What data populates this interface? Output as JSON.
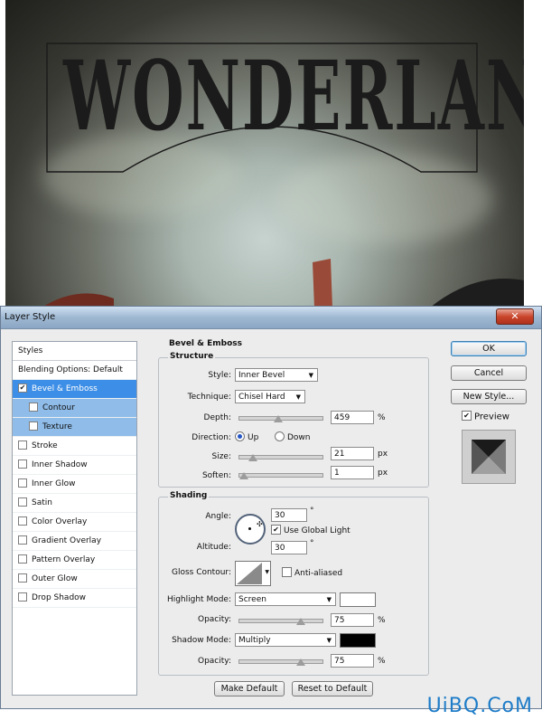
{
  "artwork": {
    "title_text": "WONDERLAND"
  },
  "dialog": {
    "title": "Layer Style",
    "close_glyph": "✕",
    "styles_header": "Styles",
    "style_items": [
      {
        "label": "Blending Options: Default",
        "checkbox": false,
        "checked": false,
        "selected": false,
        "indent": false
      },
      {
        "label": "Bevel & Emboss",
        "checkbox": true,
        "checked": true,
        "selected": true,
        "indent": false
      },
      {
        "label": "Contour",
        "checkbox": true,
        "checked": false,
        "selected": false,
        "indent": true
      },
      {
        "label": "Texture",
        "checkbox": true,
        "checked": false,
        "selected": false,
        "indent": true
      },
      {
        "label": "Stroke",
        "checkbox": true,
        "checked": false,
        "selected": false,
        "indent": false
      },
      {
        "label": "Inner Shadow",
        "checkbox": true,
        "checked": false,
        "selected": false,
        "indent": false
      },
      {
        "label": "Inner Glow",
        "checkbox": true,
        "checked": false,
        "selected": false,
        "indent": false
      },
      {
        "label": "Satin",
        "checkbox": true,
        "checked": false,
        "selected": false,
        "indent": false
      },
      {
        "label": "Color Overlay",
        "checkbox": true,
        "checked": false,
        "selected": false,
        "indent": false
      },
      {
        "label": "Gradient Overlay",
        "checkbox": true,
        "checked": false,
        "selected": false,
        "indent": false
      },
      {
        "label": "Pattern Overlay",
        "checkbox": true,
        "checked": false,
        "selected": false,
        "indent": false
      },
      {
        "label": "Outer Glow",
        "checkbox": true,
        "checked": false,
        "selected": false,
        "indent": false
      },
      {
        "label": "Drop Shadow",
        "checkbox": true,
        "checked": false,
        "selected": false,
        "indent": false
      }
    ],
    "section_title": "Bevel & Emboss",
    "structure": {
      "title": "Structure",
      "style_label": "Style:",
      "style_value": "Inner Bevel",
      "technique_label": "Technique:",
      "technique_value": "Chisel Hard",
      "depth_label": "Depth:",
      "depth_value": "459",
      "depth_unit": "%",
      "depth_fraction": 0.45,
      "direction_label": "Direction:",
      "direction_up": "Up",
      "direction_down": "Down",
      "direction_selected": "Up",
      "size_label": "Size:",
      "size_value": "21",
      "size_unit": "px",
      "size_fraction": 0.12,
      "soften_label": "Soften:",
      "soften_value": "1",
      "soften_unit": "px",
      "soften_fraction": 0.0
    },
    "shading": {
      "title": "Shading",
      "angle_label": "Angle:",
      "angle_value": "30",
      "angle_unit": "°",
      "global_light_label": "Use Global Light",
      "global_light_checked": true,
      "altitude_label": "Altitude:",
      "altitude_value": "30",
      "altitude_unit": "°",
      "gloss_label": "Gloss Contour:",
      "antialiased_label": "Anti-aliased",
      "antialiased_checked": false,
      "highlight_label": "Highlight Mode:",
      "highlight_value": "Screen",
      "highlight_color": "#ffffff",
      "highlight_opacity_label": "Opacity:",
      "highlight_opacity_value": "75",
      "highlight_opacity_unit": "%",
      "highlight_opacity_fraction": 0.75,
      "shadow_label": "Shadow Mode:",
      "shadow_value": "Multiply",
      "shadow_color": "#000000",
      "shadow_opacity_label": "Opacity:",
      "shadow_opacity_value": "75",
      "shadow_opacity_unit": "%",
      "shadow_opacity_fraction": 0.75
    },
    "buttons": {
      "ok": "OK",
      "cancel": "Cancel",
      "new_style": "New Style...",
      "preview": "Preview",
      "preview_checked": true,
      "make_default": "Make Default",
      "reset_default": "Reset to Default"
    }
  },
  "watermark": "UiBQ.CoM"
}
